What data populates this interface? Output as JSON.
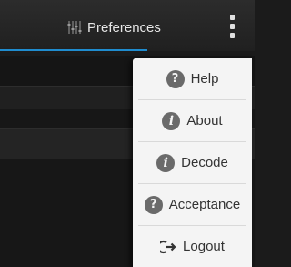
{
  "actionbar": {
    "title": "Preferences",
    "title_icon": "preferences-sliders-icon",
    "overflow_icon": "overflow-menu-icon"
  },
  "menu": {
    "items": [
      {
        "label": "Help",
        "icon": "help-icon"
      },
      {
        "label": "About",
        "icon": "info-icon"
      },
      {
        "label": "Decode",
        "icon": "info-icon"
      },
      {
        "label": "Acceptance",
        "icon": "help-icon"
      },
      {
        "label": "Logout",
        "icon": "logout-icon"
      }
    ]
  },
  "colors": {
    "accent": "#1f8ccf",
    "menu_background": "#f4f4f4",
    "actionbar_background": "#2a2a2a"
  }
}
